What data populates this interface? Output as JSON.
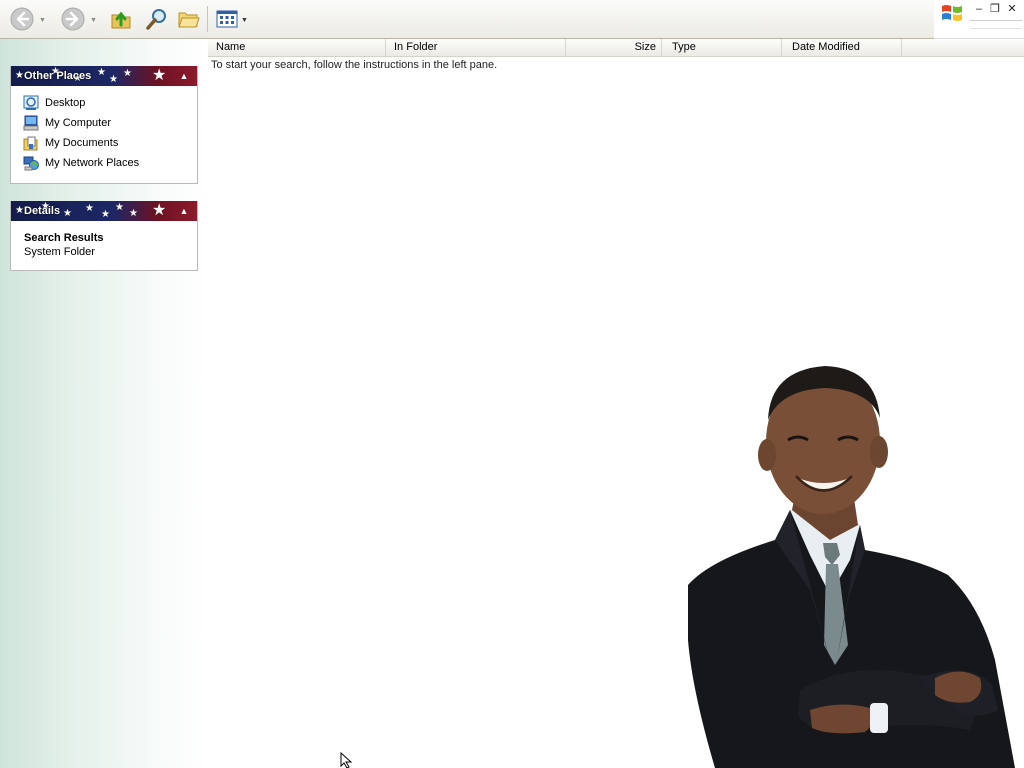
{
  "toolbar": {
    "back_icon": "back-arrow-icon",
    "forward_icon": "forward-arrow-icon",
    "up_icon": "folder-up-icon",
    "search_icon": "search-magnifier-icon",
    "folders_icon": "folders-icon",
    "views_icon": "views-grid-icon"
  },
  "list": {
    "columns": [
      "Name",
      "In Folder",
      "Size",
      "Type",
      "Date Modified"
    ],
    "hint": "To start your search, follow the instructions in the left pane."
  },
  "other_places": {
    "title": "Other Places",
    "items": [
      {
        "label": "Desktop",
        "icon": "desktop-icon"
      },
      {
        "label": "My Computer",
        "icon": "my-computer-icon"
      },
      {
        "label": "My Documents",
        "icon": "my-documents-icon"
      },
      {
        "label": "My Network Places",
        "icon": "network-places-icon"
      }
    ]
  },
  "details": {
    "title": "Details",
    "name": "Search Results",
    "type": "System Folder"
  },
  "colors": {
    "panel_header_blue": "#1d2765",
    "panel_header_red": "#8c1a2c"
  }
}
